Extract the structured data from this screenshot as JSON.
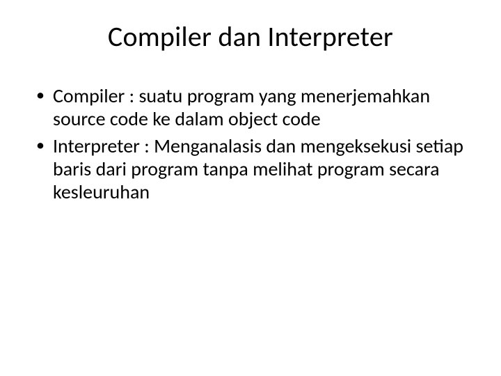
{
  "slide": {
    "title": "Compiler dan Interpreter",
    "bullets": [
      "Compiler : suatu program yang menerjemahkan source  code ke dalam object code",
      "Interpreter : Menganalasis dan mengeksekusi setiap baris dari program tanpa melihat program secara kesleuruhan"
    ]
  }
}
